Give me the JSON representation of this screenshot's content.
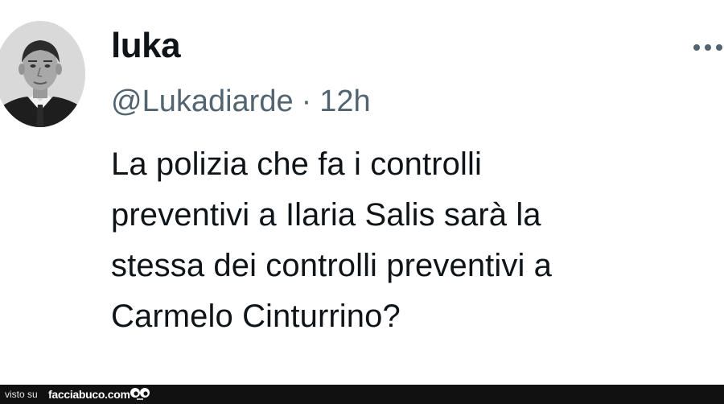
{
  "tweet": {
    "display_name": "luka",
    "handle": "@Lukadiarde",
    "separator": "·",
    "time": "12h",
    "more_icon": "more-horizontal-icon",
    "text_lines": [
      "La polizia che fa i controlli",
      "preventivi a Ilaria Salis sarà la",
      "stessa dei controlli preventivi a",
      "Carmelo Cinturrino?"
    ]
  },
  "footer": {
    "prefix": "visto su",
    "site": "facciabuco.com",
    "logo_icon": "facciabuco-eyes-logo"
  },
  "colors": {
    "text": "#0f1419",
    "secondary": "#536471",
    "footer_bg": "#111111"
  }
}
